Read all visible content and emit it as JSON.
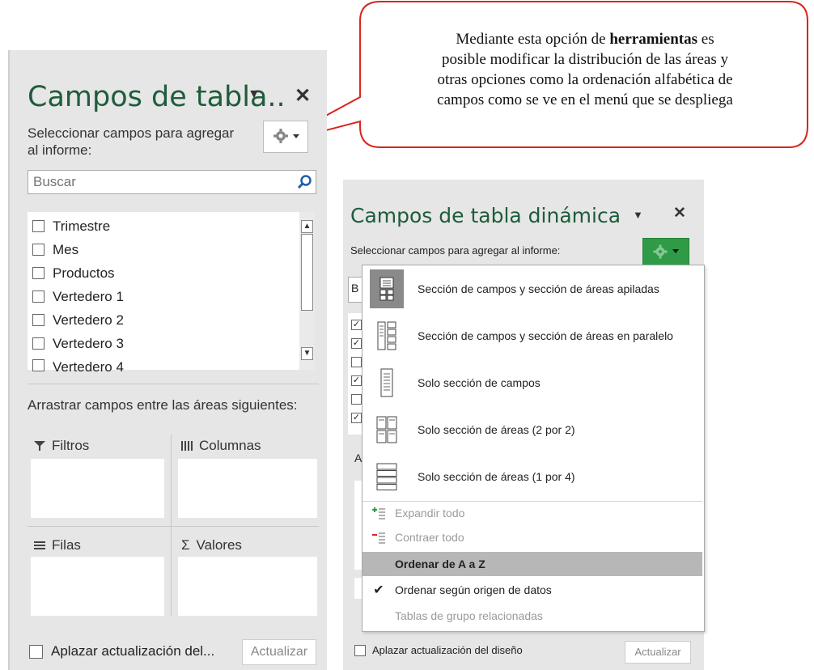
{
  "callout": {
    "line1_pre": "Mediante esta opción de ",
    "line1_bold": "herramientas",
    "line1_post": " es",
    "line2": "posible modificar la distribución de las áreas y",
    "line3": "otras opciones como la ordenación alfabética de",
    "line4": "campos como se ve en el menú que se despliega",
    "border_color": "#d9251c"
  },
  "left_pane": {
    "title": "Campos de tabla..",
    "subtitle_line1": "Seleccionar campos para agregar",
    "subtitle_line2": "al informe:",
    "search_placeholder": "Buscar",
    "fields": [
      "Trimestre",
      "Mes",
      "Productos",
      "Vertedero 1",
      "Vertedero 2",
      "Vertedero 3",
      "Vertedero 4"
    ],
    "drag_label": "Arrastrar campos entre las áreas siguientes:",
    "areas": {
      "filters": "Filtros",
      "columns": "Columnas",
      "rows": "Filas",
      "values": "Valores"
    },
    "defer_label": "Aplazar actualización del...",
    "update_button": "Actualizar",
    "accent_color": "#1e5c3b"
  },
  "right_pane": {
    "title": "Campos de tabla dinámica",
    "subtitle": "Seleccionar campos para agregar al informe:",
    "search_partial": "B",
    "area_partial": "A",
    "defer_label": "Aplazar actualización del diseño",
    "update_button": "Actualizar",
    "gear_color": "#2f9b47"
  },
  "menu": {
    "layout_options": [
      "Sección de campos y sección de áreas apiladas",
      "Sección de campos y sección de áreas en paralelo",
      "Solo sección de campos",
      "Solo sección de áreas (2 por 2)",
      "Solo sección de áreas (1 por 4)"
    ],
    "expand_all": "Expandir todo",
    "collapse_all": "Contraer todo",
    "sort_az": "Ordenar de A a Z",
    "sort_source": "Ordenar según origen de datos",
    "related_tables": "Tablas de grupo relacionadas"
  }
}
